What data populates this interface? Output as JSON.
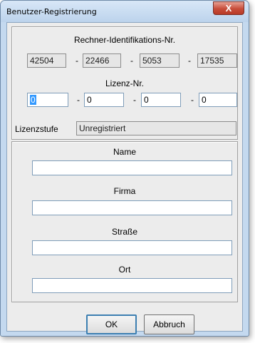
{
  "window": {
    "title": "Benutzer-Registrierung",
    "close_symbol": "X"
  },
  "computer_id": {
    "heading": "Rechner-Identifikations-Nr.",
    "parts": [
      "42504",
      "22466",
      "5053",
      "17535"
    ],
    "separator": "-"
  },
  "license": {
    "heading": "Lizenz-Nr.",
    "parts": [
      "0",
      "0",
      "0",
      "0"
    ],
    "separator": "-"
  },
  "license_level": {
    "label": "Lizenzstufe",
    "value": "Unregistriert"
  },
  "user": {
    "name_label": "Name",
    "name_value": "",
    "company_label": "Firma",
    "company_value": "",
    "street_label": "Straße",
    "street_value": "",
    "city_label": "Ort",
    "city_value": ""
  },
  "buttons": {
    "ok": "OK",
    "cancel": "Abbruch"
  }
}
